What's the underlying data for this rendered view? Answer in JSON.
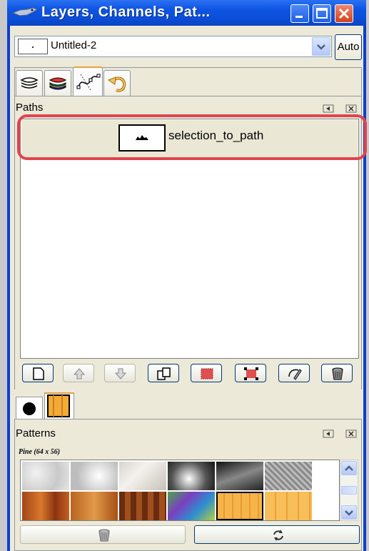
{
  "window": {
    "title": "Layers, Channels, Pat...",
    "buttons": [
      "minimize-button",
      "maximize-button",
      "close-button"
    ]
  },
  "image_selector": {
    "value": "Untitled-2",
    "auto_label": "Auto"
  },
  "top_dock": {
    "tabs": [
      {
        "name": "layers",
        "icon": "layers-icon",
        "active": false
      },
      {
        "name": "channels",
        "icon": "channels-icon",
        "active": false
      },
      {
        "name": "paths",
        "icon": "paths-icon",
        "active": true
      },
      {
        "name": "undo-history",
        "icon": "undo-history-icon",
        "active": false
      }
    ],
    "panel_title": "Paths",
    "paths": [
      {
        "name": "selection_to_path",
        "highlighted": true
      }
    ],
    "toolbar": [
      {
        "name": "new-path",
        "icon": "new-path-icon",
        "enabled": true
      },
      {
        "name": "raise-path",
        "icon": "arrow-up-icon",
        "enabled": false
      },
      {
        "name": "lower-path",
        "icon": "arrow-down-icon",
        "enabled": false
      },
      {
        "name": "duplicate-path",
        "icon": "duplicate-icon",
        "enabled": true
      },
      {
        "name": "path-to-selection",
        "icon": "path-to-selection-icon",
        "enabled": true
      },
      {
        "name": "selection-to-path",
        "icon": "selection-to-path-icon",
        "enabled": true
      },
      {
        "name": "stroke-path",
        "icon": "stroke-path-icon",
        "enabled": true
      },
      {
        "name": "delete-path",
        "icon": "trash-icon",
        "enabled": true
      }
    ]
  },
  "bottom_dock": {
    "tabs": [
      {
        "name": "brushes",
        "icon": "brush-icon",
        "active": false
      },
      {
        "name": "patterns",
        "icon": "pattern-icon",
        "active": true
      }
    ],
    "panel_title": "Patterns",
    "selected_pattern": "Pine (64 x 56)",
    "buttons": [
      {
        "name": "delete-pattern",
        "icon": "trash-icon",
        "enabled": false
      },
      {
        "name": "refresh-patterns",
        "icon": "refresh-icon",
        "enabled": true
      }
    ]
  },
  "colors": {
    "titlebar": "#0b4ed8",
    "highlight": "#e0444e",
    "tab_accent": "#e6a23a"
  }
}
